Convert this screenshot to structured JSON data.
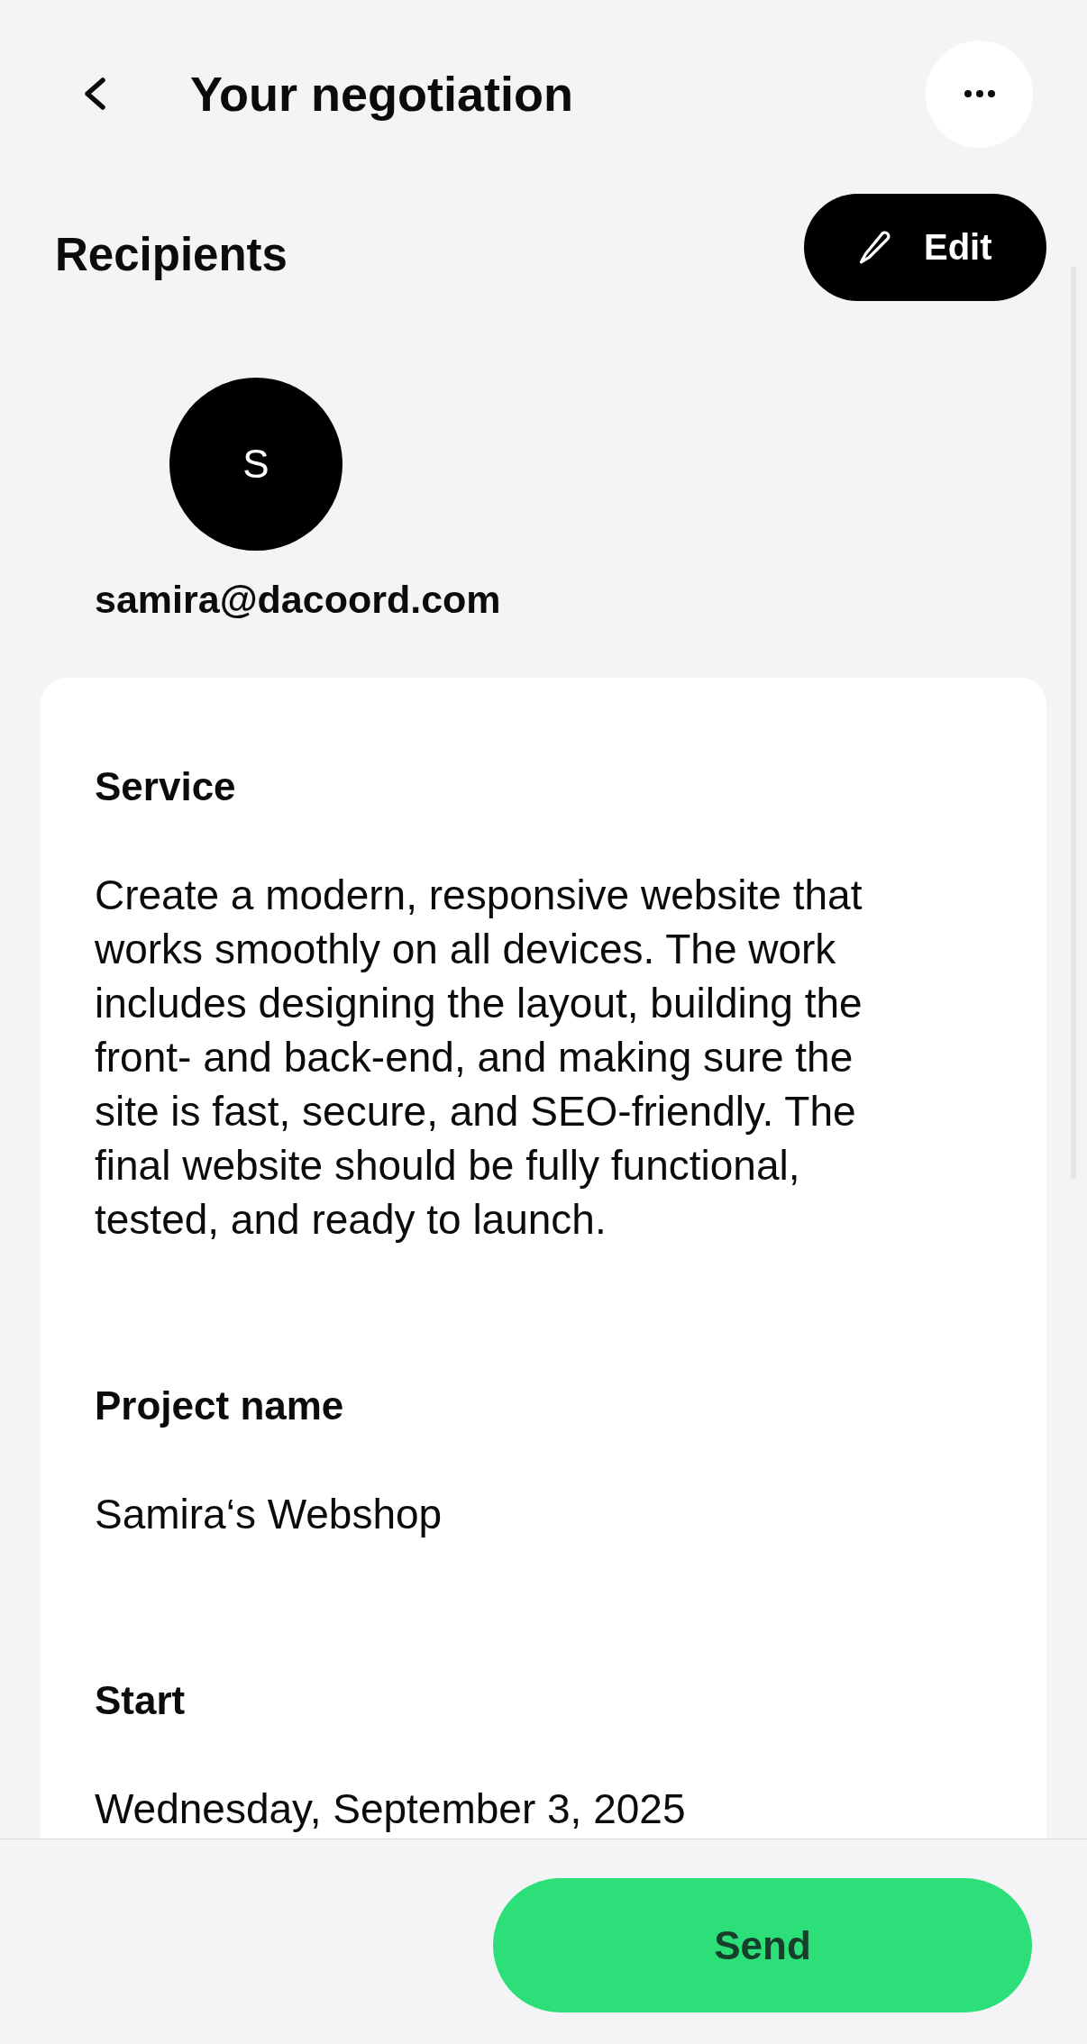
{
  "header": {
    "title": "Your negotiation"
  },
  "recipients": {
    "heading": "Recipients",
    "edit_button": "Edit",
    "people": [
      {
        "initial": "S",
        "email": "samira@dacoord.com"
      }
    ]
  },
  "details": [
    {
      "label": "Service",
      "value": "Create a modern, responsive website that works smoothly on all devices. The work includes designing the layout, building the front- and back-end, and making sure the site is fast, secure, and SEO-friendly. The final website should be fully functional, tested, and ready to launch."
    },
    {
      "label": "Project name",
      "value": "Samira‘s Webshop"
    },
    {
      "label": "Start",
      "value": "Wednesday, September 3, 2025"
    }
  ],
  "footer": {
    "send_button": "Send"
  }
}
